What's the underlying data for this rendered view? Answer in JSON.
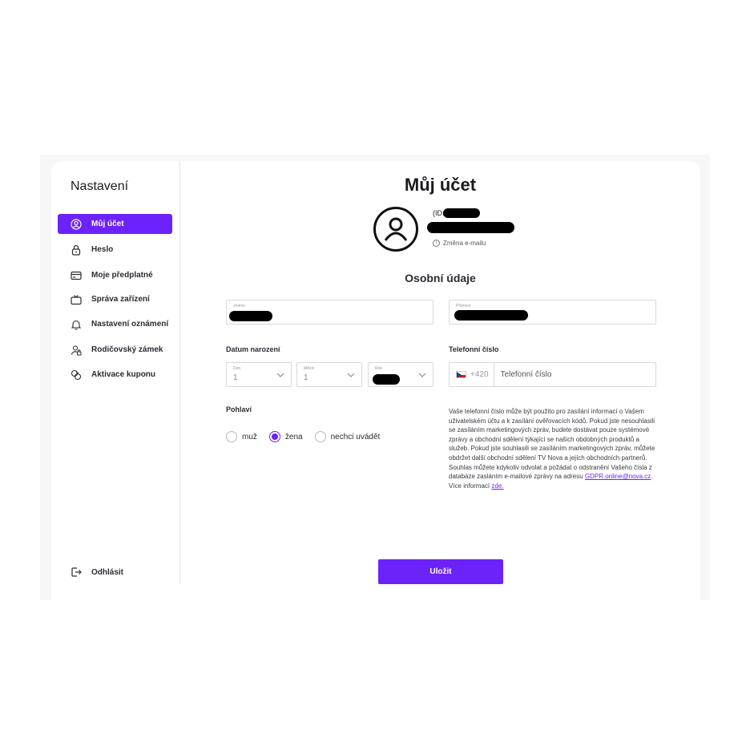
{
  "sidebar": {
    "title": "Nastavení",
    "items": [
      {
        "label": "Můj účet",
        "icon": "user-circle-icon",
        "active": true
      },
      {
        "label": "Heslo",
        "icon": "lock-icon"
      },
      {
        "label": "Moje předplatné",
        "icon": "credit-card-icon"
      },
      {
        "label": "Správa zařízení",
        "icon": "tv-icon"
      },
      {
        "label": "Nastavení oznámení",
        "icon": "bell-icon"
      },
      {
        "label": "Rodičovský zámek",
        "icon": "parental-lock-icon"
      },
      {
        "label": "Aktivace kuponu",
        "icon": "coupon-icon"
      }
    ],
    "logout_label": "Odhlásit"
  },
  "main": {
    "title": "Můj účet",
    "id_prefix": "(ID:",
    "change_email": "Změna e-mailu",
    "section_title": "Osobní údaje",
    "first_name_label": "Jméno",
    "last_name_label": "Příjmení",
    "birth_label": "Datum narození",
    "day_label": "Den",
    "day_value": "1",
    "month_label": "Měsíc",
    "month_value": "1",
    "year_label": "Rok",
    "phone_label": "Telefonní číslo",
    "phone_prefix": "+420",
    "phone_placeholder": "Telefonní číslo",
    "gender_label": "Pohlaví",
    "gender_options": [
      "muž",
      "žena",
      "nechci uvádět"
    ],
    "gender_selected": "žena",
    "consent_text": "Vaše telefonní číslo může být použito pro zasílání informací o Vašem uživatelském účtu a k zasílání ověřovacích kódů. Pokud jste nesouhlasili se zasíláním marketingových zpráv, budete dostávat pouze systémové zprávy a obchodní sdělení týkající se našich obdobných produktů a služeb. Pokud jste souhlasili se zasíláním marketingových zpráv, můžete obdržet další obchodní sdělení TV Nova a jejích obchodních partnerů. Souhlas můžete kdykoliv odvolat a požádat o odstranění Vašeho čísla z databáze zasláním e-mailové zprávy na adresu",
    "consent_email": "GDPR.online@nova.cz",
    "consent_more": ". Více informací",
    "consent_link": "zde.",
    "save_label": "Uložit"
  },
  "colors": {
    "accent": "#6c22fb"
  }
}
